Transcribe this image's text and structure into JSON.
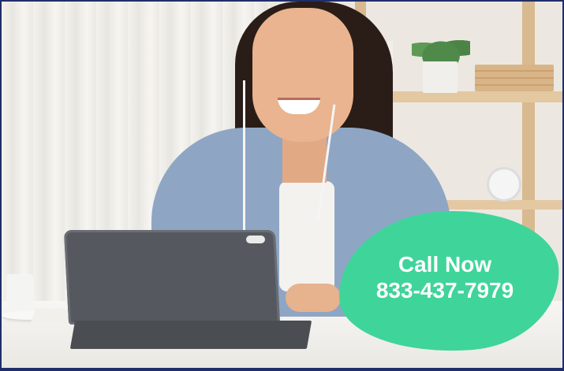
{
  "cta": {
    "label": "Call Now",
    "phone": "833-437-7979",
    "blob_color": "#3fd49a",
    "text_color": "#ffffff"
  },
  "frame": {
    "border_color": "#1f2e6b"
  }
}
